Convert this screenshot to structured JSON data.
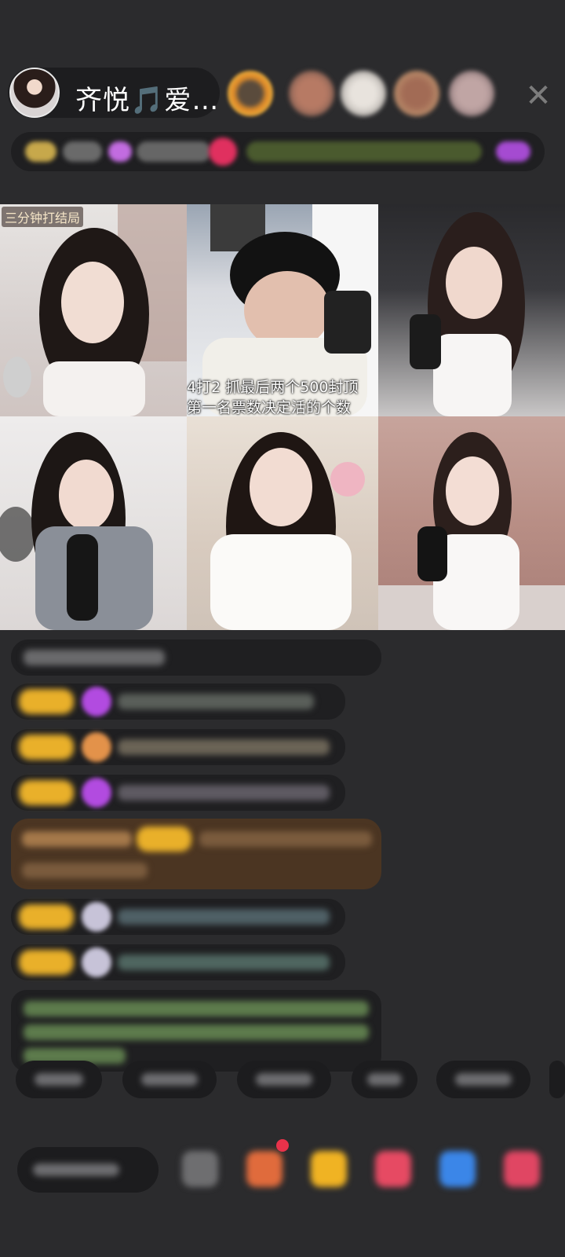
{
  "header": {
    "host_name": "齐悦🎵爱…",
    "close_glyph": "✕"
  },
  "video_grid": {
    "timer_label": "三分钟打结局",
    "rules": {
      "line1": "4打2  抓最后两个500封顶",
      "line2": "第一名票数决定活的个数"
    }
  },
  "colors": {
    "background": "#2b2b2d",
    "badge_gold": "#e9b02a",
    "chat_bubble": "#1f1f21",
    "chat_highlight": "#4b3522"
  }
}
